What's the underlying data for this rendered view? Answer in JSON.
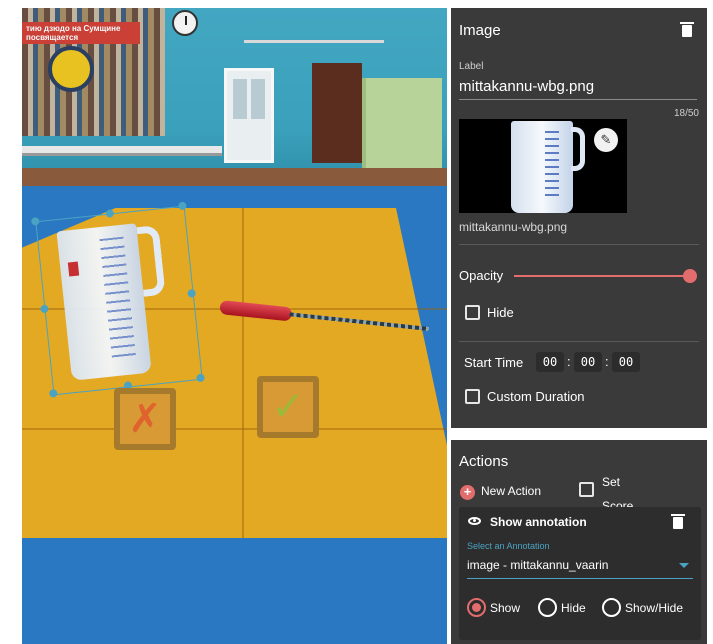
{
  "scene": {
    "poster_text": "тию дзюдо на Сумщине\nпосвящается"
  },
  "image_panel": {
    "title": "Image",
    "label_caption": "Label",
    "label_value": "mittakannu-wbg.png",
    "char_counter": "18/50",
    "thumbnail_caption": "mittakannu-wbg.png",
    "opacity_label": "Opacity",
    "opacity_fraction": 1.0,
    "hide_label": "Hide",
    "start_time_label": "Start Time",
    "start_time": {
      "hours": "00",
      "minutes": "00",
      "seconds": "00",
      "separator": ":"
    },
    "custom_duration_label": "Custom Duration"
  },
  "actions_panel": {
    "title": "Actions",
    "new_action_label": "New Action",
    "set_score_label": "Set Score",
    "annotation_card": {
      "title": "Show annotation",
      "select_label": "Select an Annotation",
      "select_value": "image - mittakannu_vaarin",
      "options": [
        {
          "label": "Show",
          "selected": true
        },
        {
          "label": "Hide",
          "selected": false
        },
        {
          "label": "Show/Hide",
          "selected": false
        }
      ]
    }
  },
  "colors": {
    "panel_bg": "#3a3a3a",
    "accent": "#e36c6c",
    "link_blue": "#4aa3c2"
  }
}
